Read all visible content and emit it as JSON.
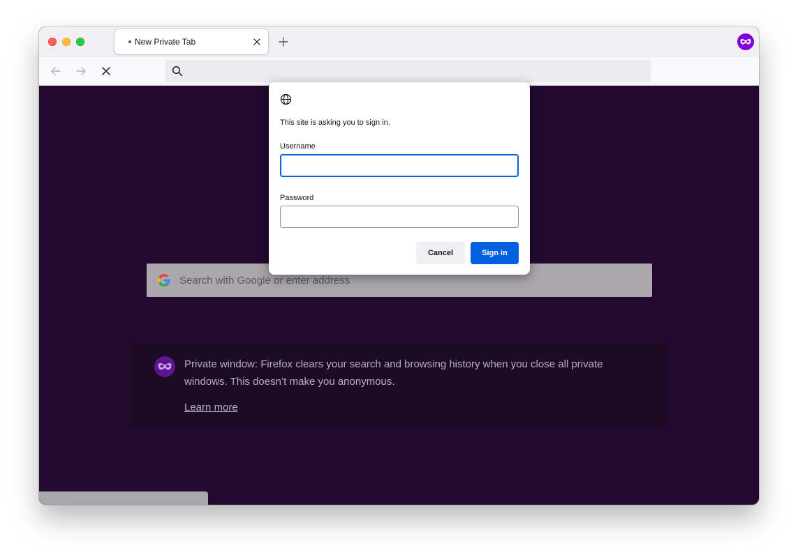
{
  "window": {
    "traffic_lights": {
      "close_color": "#fe5f57",
      "minimize_color": "#febc2e",
      "maximize_color": "#28c840"
    }
  },
  "tabs": [
    {
      "title": "New Private Tab",
      "loading_indicator": "dot-icon",
      "close_icon": "close-icon"
    }
  ],
  "toolbar": {
    "new_tab_icon": "plus-icon",
    "back_icon": "back-arrow-icon",
    "forward_icon": "forward-arrow-icon",
    "stop_icon": "stop-icon",
    "private_browsing_icon": "private-mask-icon"
  },
  "urlbar": {
    "icon": "search-icon",
    "value": ""
  },
  "new_tab_page": {
    "search_placeholder": "Search with Google or enter address",
    "search_icon": "google-logo-icon",
    "private_notice": {
      "icon": "private-mask-icon",
      "text": "Private window: Firefox clears your search and browsing history when you close all private windows. This doesn’t make you anonymous.",
      "link": "Learn more"
    }
  },
  "auth_dialog": {
    "icon": "globe-icon",
    "message": "This site is asking you to sign in.",
    "username_label": "Username",
    "username_value": "",
    "password_label": "Password",
    "password_value": "",
    "cancel_label": "Cancel",
    "signin_label": "Sign in",
    "accent_color": "#0061e0"
  },
  "theme": {
    "private_background": "#23092f",
    "private_accent": "#8000d7"
  }
}
